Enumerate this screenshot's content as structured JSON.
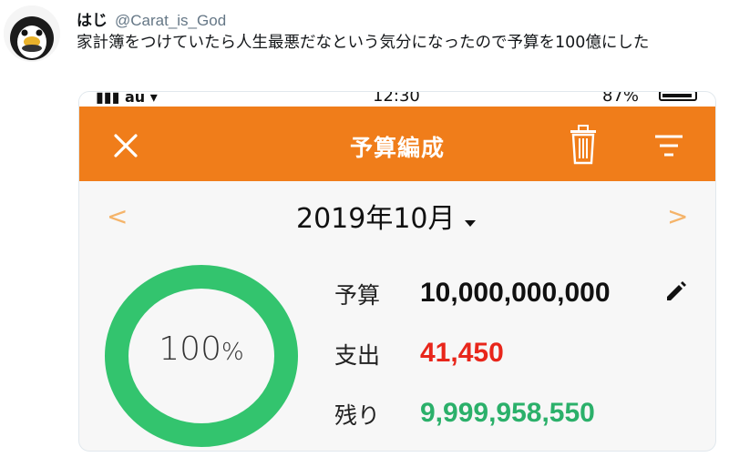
{
  "tweet": {
    "display_name": "はじ",
    "handle": "@Carat_is_God",
    "text": "家計簿をつけていたら人生最悪だなという気分になったので予算を100億にした"
  },
  "app": {
    "title": "予算編成",
    "month": "2019年10月",
    "ring_percent": "100",
    "ring_percent_unit": "%",
    "rows": {
      "budget_label": "予算",
      "budget_value": "10,000,000,000",
      "spent_label": "支出",
      "spent_value": "41,450",
      "remain_label": "残り",
      "remain_value": "9,999,958,550"
    },
    "nav": {
      "prev": "<",
      "next": ">"
    },
    "colors": {
      "header": "#f07d1a",
      "ring": "#33c46e",
      "spent": "#e8261b",
      "remain": "#2bb06a",
      "nav": "#f5b46a"
    },
    "icons": [
      "close-icon",
      "trash-icon",
      "filter-icon",
      "pencil-icon",
      "caret-down-icon"
    ]
  }
}
